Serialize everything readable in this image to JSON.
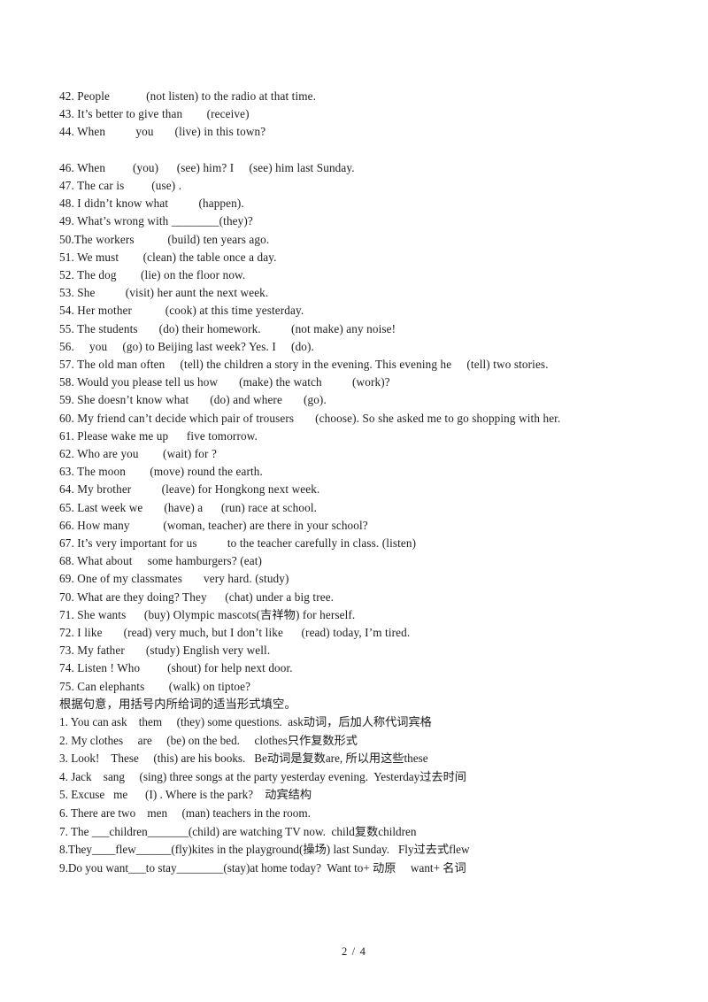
{
  "document": {
    "page_label": "2 / 4"
  },
  "exercises": {
    "lines": [
      "42. People            (not listen) to the radio at that time.",
      "43. It’s better to give than        (receive)",
      "44. When          you       (live) in this town?",
      "",
      "46. When         (you)      (see) him? I     (see) him last Sunday.",
      "47. The car is         (use) .",
      "48. I didn’t know what          (happen).",
      "49. What’s wrong with ________(they)?",
      "50.The workers           (build) ten years ago.",
      "51. We must        (clean) the table once a day.",
      "52. The dog        (lie) on the floor now.",
      "53. She          (visit) her aunt the next week.",
      "54. Her mother           (cook) at this time yesterday.",
      "55. The students       (do) their homework.          (not make) any noise!",
      "56.     you     (go) to Beijing last week? Yes. I     (do).",
      "57. The old man often     (tell) the children a story in the evening. This evening he     (tell) two stories.",
      "58. Would you please tell us how       (make) the watch          (work)?",
      "59. She doesn’t know what       (do) and where       (go).",
      "60. My friend can’t decide which pair of trousers       (choose). So she asked me to go shopping with her.",
      "61. Please wake me up      five tomorrow.",
      "62. Who are you        (wait) for ?",
      "63. The moon        (move) round the earth.",
      "64. My brother          (leave) for Hongkong next week.",
      "65. Last week we       (have) a      (run) race at school.",
      "66. How many           (woman, teacher) are there in your school?",
      "67. It’s very important for us          to the teacher carefully in class. (listen)",
      "68. What about     some hamburgers? (eat)",
      "69. One of my classmates       very hard. (study)",
      "70. What are they doing? They      (chat) under a big tree.",
      "71. She wants      (buy) Olympic mascots(吉祥物) for herself.",
      "72. I like       (read) very much, but I don’t like      (read) today, I’m tired.",
      "73. My father       (study) English very well.",
      "74. Listen ! Who         (shout) for help next door.",
      "75. Can elephants        (walk) on tiptoe?"
    ]
  },
  "section_two": {
    "instruction": "根据句意，用括号内所给词的适当形式填空。",
    "answers": [
      "1. You can ask    them     (they) some questions.  ask动词，后加人称代词宾格",
      "2. My clothes     are     (be) on the bed.     clothes只作复数形式",
      "3. Look!    These     (this) are his books.   Be动词是复数are, 所以用这些these",
      "4. Jack    sang     (sing) three songs at the party yesterday evening.  Yesterday过去时间",
      "5. Excuse   me      (I) . Where is the park?    动宾结构",
      "6. There are two    men     (man) teachers in the room.",
      "7. The ___children_______(child) are watching TV now.  child复数children",
      "8.They____flew______(fly)kites in the playground(操场) last Sunday.   Fly过去式flew",
      "9.Do you want___to stay________(stay)at home today?  Want to+ 动原     want+ 名词"
    ]
  }
}
